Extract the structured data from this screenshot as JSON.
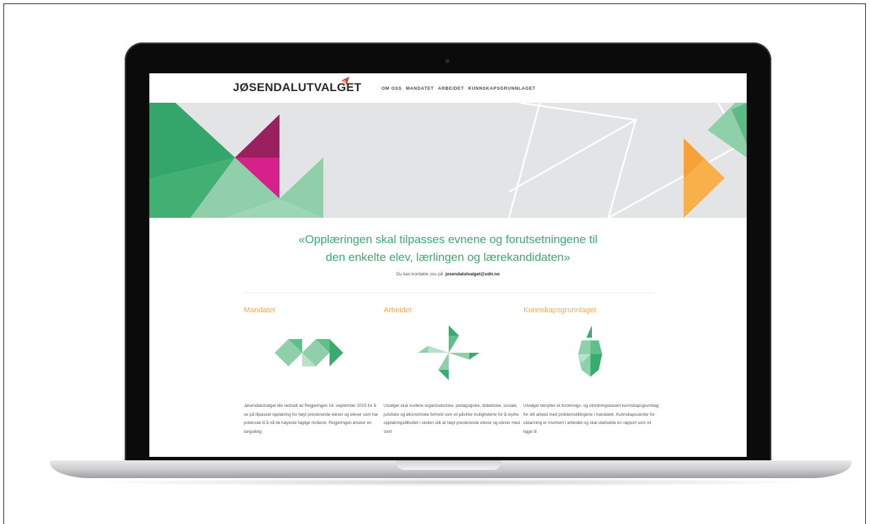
{
  "site": {
    "logo_text": "JØSENDALUTVALGET",
    "nav": [
      "OM OSS",
      "MANDATET",
      "ARBEIDET",
      "KUNNSKAPSGRUNNLAGET"
    ],
    "quote_line1": "«Opplæringen skal tilpasses evnene og forutsetningene til",
    "quote_line2": "den enkelte elev, lærlingen og lærekandidaten»",
    "contact_prefix": "Du kan kontakte oss på: ",
    "contact_email": "josendalutvalget@udir.no",
    "columns": [
      {
        "title": "Mandatet",
        "icon": "m-shape-icon",
        "text": "Jøsendalutvalget ble nedsatt av Regjeringen 18. september 2015 for å se på tilpasset opplæring for høyt presterende elever og elever som har potensial til å nå de høyeste faglige nivåene. Regjeringen ønsker en langsiktig"
      },
      {
        "title": "Arbeidet",
        "icon": "pinwheel-icon",
        "text": "Utvalget skal vurdere organisatoriske, pedagogiske, didaktiske, sosiale, juridiske og økonomiske forhold som vil påvirke mulighetene for å styrke opplæringstilbudet i skolen slik at høyt presterende elever og elever med stort"
      },
      {
        "title": "Kunnskapsgrunnlaget",
        "icon": "apple-icon",
        "text": "Utvalget benytter et forsknings- og utredningsbasert kunnskapsgrunnlag for sitt arbeid med problemstillingene i mandatet. Kunnskapssenter for utdanning er involvert i arbeidet og skal utarbeide en rapport som vil ligge til"
      }
    ]
  },
  "colors": {
    "green": "#3aab6f",
    "light_green": "#8fcfa9",
    "magenta": "#d6208a",
    "purple": "#9a2060",
    "orange": "#f8b04a",
    "hero_bg": "#e3e4e6"
  }
}
